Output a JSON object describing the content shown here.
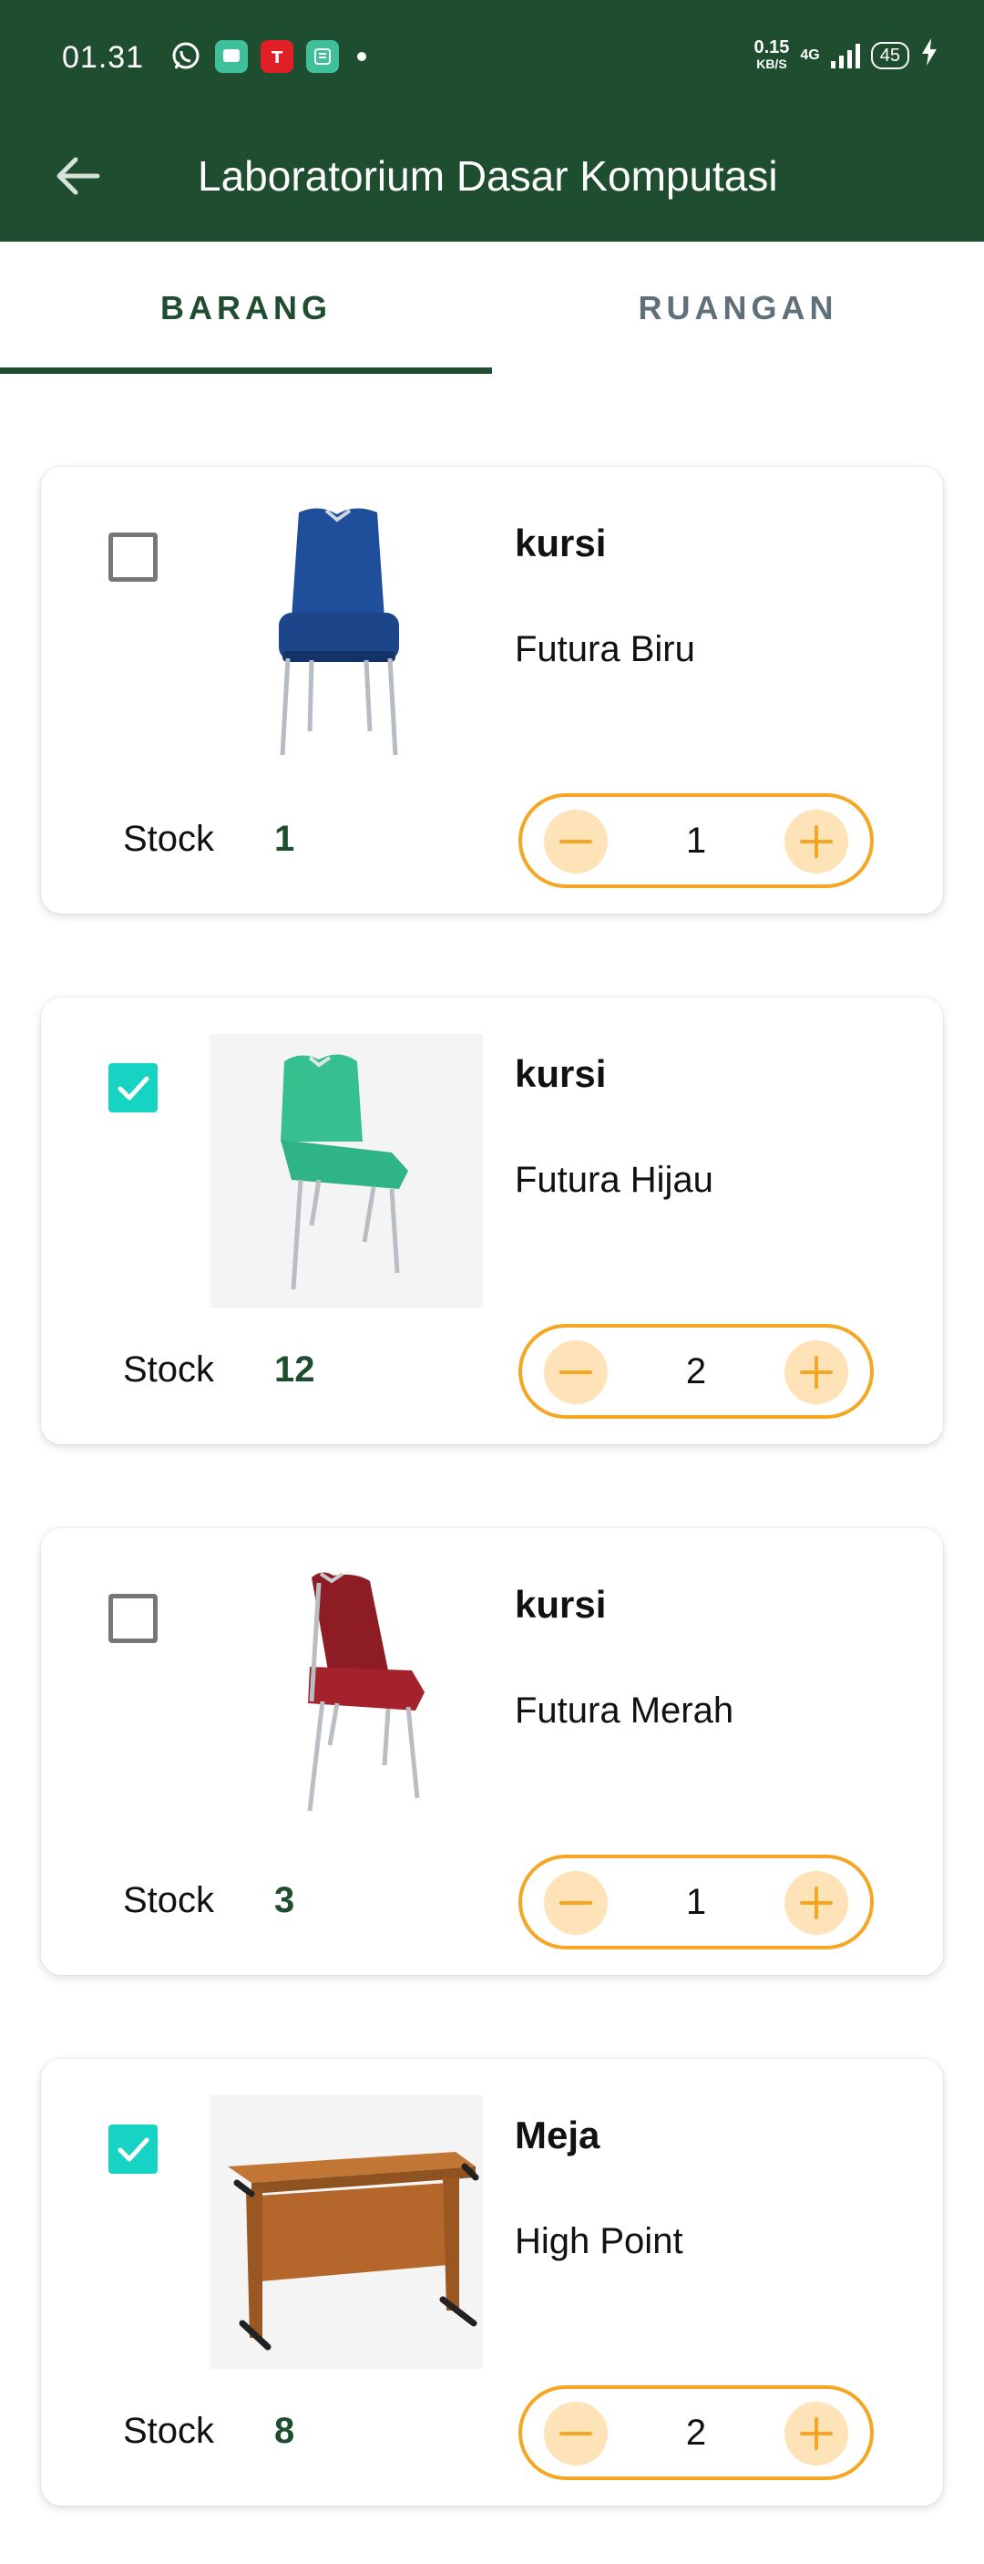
{
  "status_bar": {
    "time": "01.31",
    "speed_value": "0.15",
    "speed_unit": "KB/S",
    "network": "4G",
    "battery": "45",
    "app_icons": [
      "whatsapp-icon",
      "messages-icon",
      "telkomsel-icon",
      "app-icon"
    ]
  },
  "appbar": {
    "title": "Laboratorium Dasar Komputasi"
  },
  "tabs": [
    {
      "label": "BARANG",
      "active": true
    },
    {
      "label": "RUANGAN",
      "active": false
    }
  ],
  "stock_label": "Stock",
  "items": [
    {
      "name": "kursi",
      "description": "Futura Biru",
      "stock": "1",
      "quantity": "1",
      "checked": false,
      "image": "blue-chair",
      "color": "#1f4f9a"
    },
    {
      "name": "kursi",
      "description": "Futura Hijau",
      "stock": "12",
      "quantity": "2",
      "checked": true,
      "image": "green-chair",
      "color": "#36c08f"
    },
    {
      "name": "kursi",
      "description": "Futura Merah",
      "stock": "3",
      "quantity": "1",
      "checked": false,
      "image": "red-chair",
      "color": "#8e1c24"
    },
    {
      "name": "Meja",
      "description": "High Point",
      "stock": "8",
      "quantity": "2",
      "checked": true,
      "image": "desk",
      "color": "#b5672b"
    }
  ],
  "colors": {
    "header": "#1e4d2f",
    "accent": "#f5a623",
    "accent_light": "#ffe3b8",
    "checkbox_checked": "#17d3c4"
  }
}
